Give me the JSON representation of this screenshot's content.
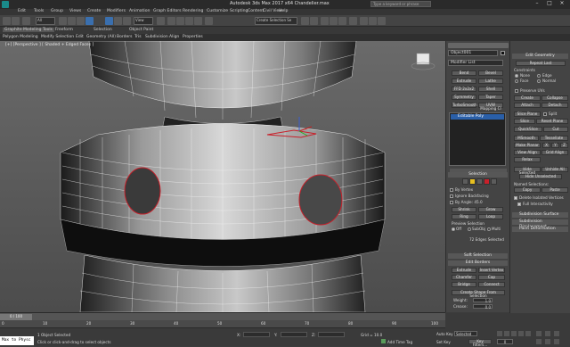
{
  "window": {
    "title": "Autodesk 3ds Max 2017 x64     Chandelier.max",
    "workspace_label": "Workspace: Default",
    "search_placeholder": "Type a keyword or phrase"
  },
  "menubar": {
    "items": [
      "Edit",
      "Tools",
      "Group",
      "Views",
      "Create",
      "Modifiers",
      "Animation",
      "Graph Editors",
      "Rendering",
      "Customize",
      "Scripting",
      "Content",
      "Civil View",
      "Help"
    ]
  },
  "toolbar": {
    "selection_filter": "All",
    "viewport_dropdown": "View",
    "named_selection": "Create Selection Se"
  },
  "ribbon": {
    "tabs": [
      "Graphite Modeling Tools",
      "Freeform",
      "Selection",
      "Object Paint"
    ],
    "row_items": [
      "Polygon Modeling",
      "Modify Selection",
      "Edit",
      "Geometry (All)",
      "Borders",
      "Tris",
      "Subdivision",
      "Align",
      "Properties"
    ]
  },
  "viewport": {
    "label": "[+] [Perspective ] [ Shaded + Edged Faces ]"
  },
  "command_panel": {
    "object_name": "Object001",
    "modifier_list": "Modifier List",
    "modifier_buttons": [
      [
        "Bend",
        "Bevel"
      ],
      [
        "Extrude",
        "Lathe"
      ],
      [
        "FFD 2x2x2",
        "Shell"
      ],
      [
        "Symmetry",
        "Taper"
      ],
      [
        "TurboSmooth",
        "UVW Mapping Cl"
      ]
    ],
    "stack_item": "Editable Poly",
    "selection_header": "Selection",
    "by_vertex": "By Vertex",
    "ignore_backfacing": "Ignore Backfacing",
    "by_angle": "By Angle: 45.0",
    "shrink": "Shrink",
    "grow": "Grow",
    "ring": "Ring",
    "loop": "Loop",
    "preview_selection": "Preview Selection",
    "preview_off": "Off",
    "preview_subobj": "SubObj",
    "preview_multi": "Multi",
    "selected_status": "72 Edges Selected",
    "soft_selection": "Soft Selection",
    "edit_borders": "Edit Borders",
    "extrude": "Extrude",
    "insert_vertex": "Insert Vertex",
    "chamfer": "Chamfer",
    "cap": "Cap",
    "bridge": "Bridge",
    "connect": "Connect",
    "create_shape": "Create Shape From Selection",
    "weight": "Weight:",
    "weight_val": "1.0",
    "crease": "Crease:",
    "crease_val": "0.0",
    "edit_tri": "Edit Tri.",
    "turn": "Turn"
  },
  "edit_panel": {
    "header": "Edit Geometry",
    "repeat_last": "Repeat Last",
    "constraints": "Constraints",
    "none": "None",
    "edge": "Edge",
    "face": "Face",
    "normal": "Normal",
    "preserve_uvs": "Preserve UVs",
    "create": "Create",
    "collapse": "Collapse",
    "attach": "Attach",
    "detach": "Detach",
    "slice_plane": "Slice Plane",
    "split": "Split",
    "slice": "Slice",
    "reset_plane": "Reset Plane",
    "quickslice": "QuickSlice",
    "cut": "Cut",
    "msmooth": "MSmooth",
    "tessellate": "Tessellate",
    "make_planar": "Make Planar",
    "x": "X",
    "y": "Y",
    "z": "Z",
    "view_align": "View Align",
    "grid_align": "Grid Align",
    "relax": "Relax",
    "hide_selected": "Hide Selected",
    "unhide_all": "Unhide All",
    "hide_unselected": "Hide Unselected",
    "named_selections": "Named Selections:",
    "copy": "Copy",
    "paste": "Paste",
    "delete_isolated": "Delete Isolated Vertices",
    "full_interactivity": "Full Interactivity",
    "subdivision_surface": "Subdivision Surface",
    "subdivision_displacement": "Subdivision Displacement",
    "paint_deformation": "Paint Deformation"
  },
  "timeline": {
    "frame": "0 / 100",
    "ticks": [
      "0",
      "10",
      "20",
      "30",
      "40",
      "50",
      "60",
      "70",
      "80",
      "90",
      "100"
    ]
  },
  "status": {
    "script_label": "Max to Physc",
    "object_selected": "1 Object Selected",
    "prompt": "Click or click-and-drag to select objects",
    "x_label": "X:",
    "y_label": "Y:",
    "z_label": "Z:",
    "grid": "Grid = 10.0",
    "add_time_tag": "Add Time Tag",
    "auto_key": "Auto Key",
    "set_key": "Set Key",
    "selected_dd": "Selected",
    "key_filters": "Key Filters...",
    "frame_val": "0"
  },
  "colors": {
    "selection_red": "#c8202a",
    "stack_blue": "#2a5fa8",
    "accent_yellow": "#e8c020"
  }
}
